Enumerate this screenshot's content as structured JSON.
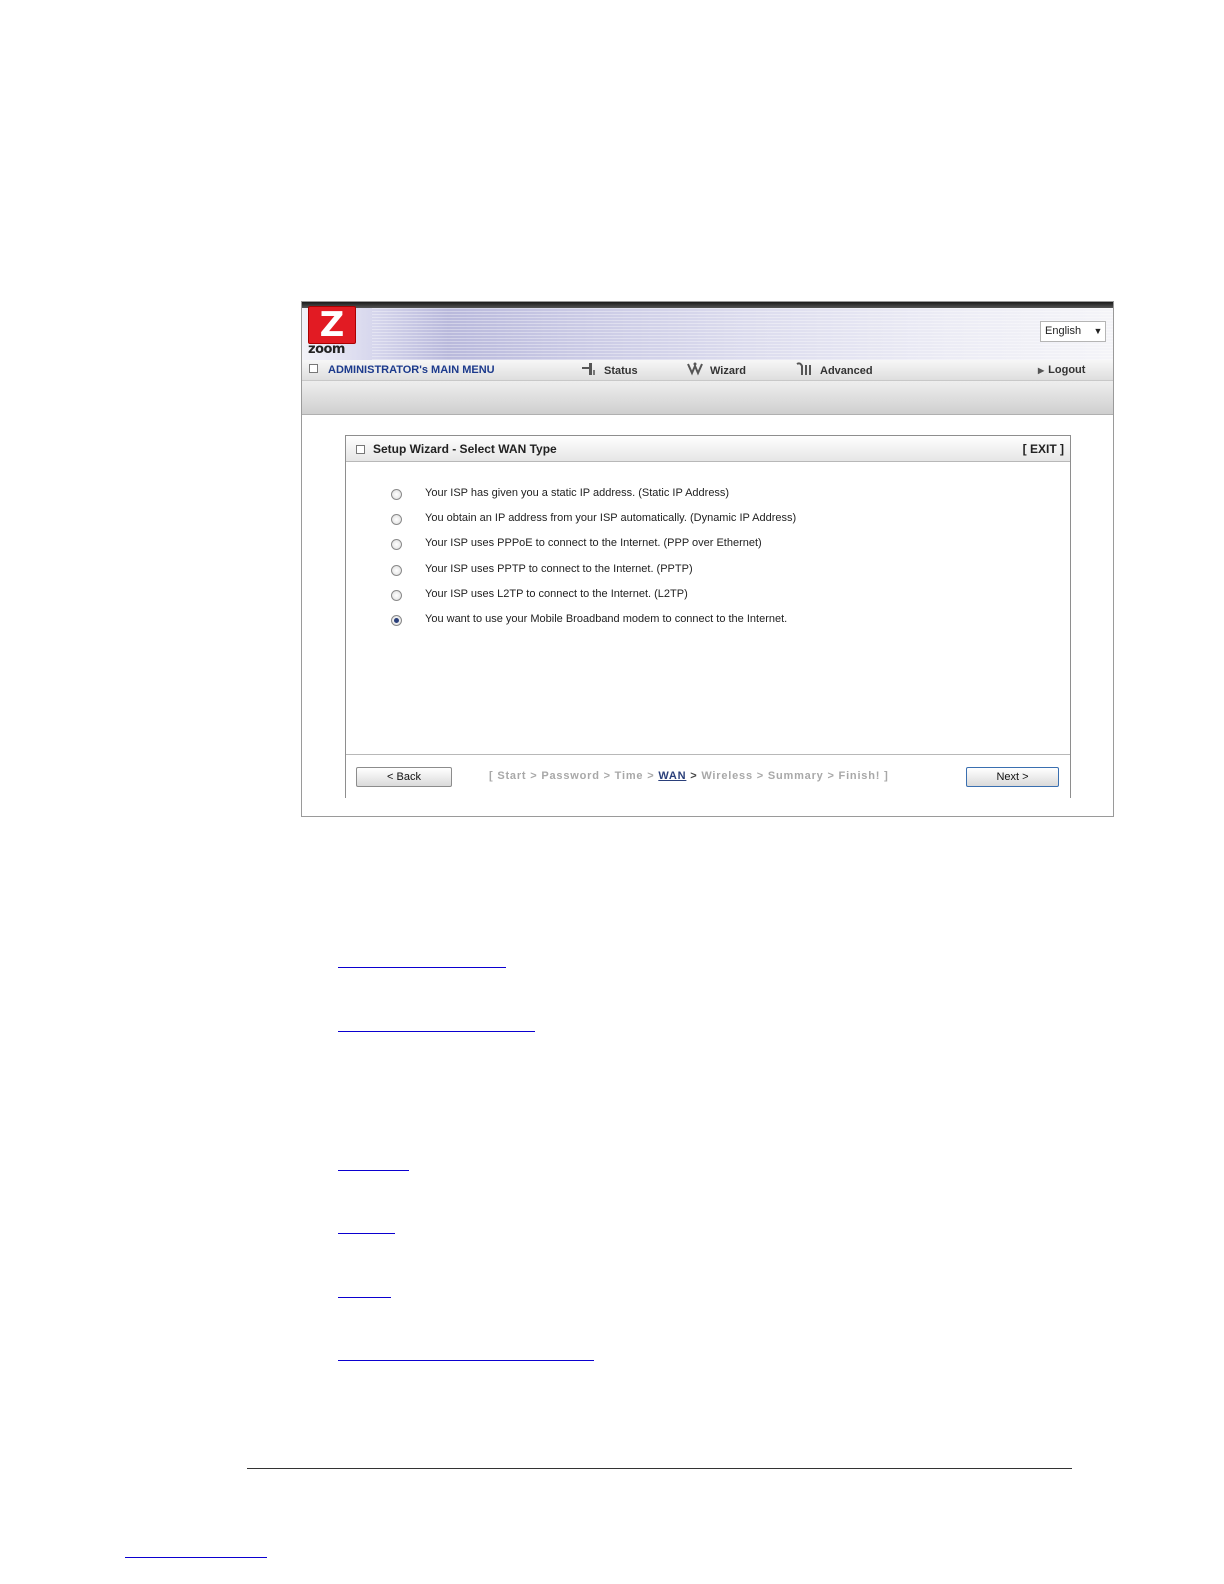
{
  "header": {
    "logo_text": "zoom",
    "language_select": {
      "selected": "English"
    }
  },
  "menu": {
    "admin_label": "ADMINISTRATOR's MAIN MENU",
    "items": [
      {
        "label": "Status",
        "icon": "status-icon"
      },
      {
        "label": "Wizard",
        "icon": "wizard-icon"
      },
      {
        "label": "Advanced",
        "icon": "advanced-icon"
      }
    ],
    "logout_label": "Logout"
  },
  "wizard": {
    "title": "Setup Wizard - Select WAN Type",
    "exit_label": "[ EXIT ]",
    "options": [
      {
        "label": "Your ISP has given you a static IP address. (Static IP Address)",
        "checked": false
      },
      {
        "label": "You obtain an IP address from your ISP automatically. (Dynamic IP Address)",
        "checked": false
      },
      {
        "label": "Your ISP uses PPPoE to connect to the Internet. (PPP over Ethernet)",
        "checked": false
      },
      {
        "label": "Your ISP uses PPTP to connect to the Internet. (PPTP)",
        "checked": false
      },
      {
        "label": "Your ISP uses L2TP to connect to the Internet. (L2TP)",
        "checked": false
      },
      {
        "label": "You want to use your Mobile Broadband modem to connect to the Internet.",
        "checked": true
      }
    ],
    "back_label": "< Back",
    "next_label": "Next >",
    "steps": {
      "open": "[",
      "start": "Start",
      "password": "Password",
      "time": "Time",
      "wan": "WAN",
      "wireless": "Wireless",
      "summary": "Summary",
      "finish": "Finish!",
      "close": "]",
      "separator": ">"
    }
  },
  "colors": {
    "link_underline": "#0b00d0",
    "menu_admin": "#1c3a8c",
    "current_step": "#2a3f7a",
    "logo_red": "#e21b23"
  }
}
